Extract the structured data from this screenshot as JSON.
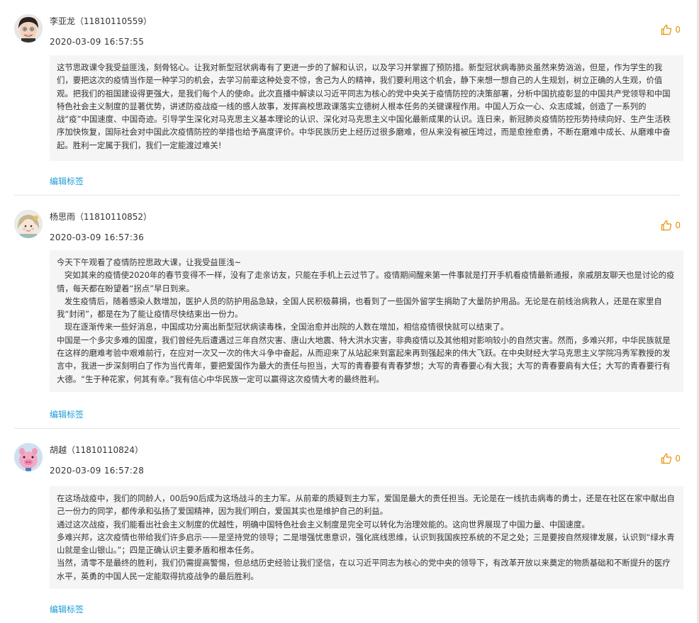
{
  "colors": {
    "accent_link": "#1e9dd6",
    "like_orange": "#e98f00",
    "content_bg": "#f5f5f5",
    "text": "#333333"
  },
  "comments": [
    {
      "author": "李亚龙（11810110559）",
      "time": "2020-03-09 16:57:55",
      "likes": "0",
      "avatar_icon": "boy-avatar-icon",
      "edit_label": "编辑标签",
      "paragraphs": [
        "这节思政课令我受益匪浅，刻骨铭心。让我对新型冠状病毒有了更进一步的了解和认识，以及学习并掌握了预防措。新型冠状病毒肺炎虽然来势汹汹，但是，作为学生的我们，要把这次的疫情当作是一种学习的机会，去学习前辈这种处变不惊，舍己为人的精神，我们要利用这个机会，静下来想一想自己的人生规划，树立正确的人生观，价值观。把我们的祖国建设得更强大，是我们每个人的使命。此次直播中解读以习近平同志为核心的党中央关于疫情防控的决策部署，分析中国抗疫彰显的中国共产党领导和中国特色社会主义制度的显著优势，讲述防疫战疫一线的感人故事，发挥高校思政课落实立德树人根本任务的关键课程作用。中国人万众一心、众志成城，创造了一系列的战“疫”中国速度、中国奇迹。引导学生深化对马克思主义基本理论的认识、深化对马克思主义中国化最新成果的认识。连日来，新冠肺炎疫情防控形势持续向好、生产生活秩序加快恢复，国际社会对中国此次疫情防控的举措也给予高度评价。中华民族历史上经历过很多磨难，但从来没有被压垮过，而是愈挫愈勇，不断在磨难中成长、从磨难中奋起。胜利一定属于我们，我们一定能渡过难关!"
      ]
    },
    {
      "author": "杨思雨（11810110852）",
      "time": "2020-03-09 16:57:36",
      "likes": "0",
      "avatar_icon": "girl-avatar-icon",
      "edit_label": "编辑标签",
      "paragraphs": [
        "今天下午观看了疫情防控思政大课，让我受益匪浅~",
        "   突如其来的疫情使2020年的春节变得不一样，没有了走亲访友，只能在手机上云过节了。疫情期间醒来第一件事就是打开手机看疫情最新通报，亲戚朋友聊天也是讨论的疫情，每天都在盼望着“拐点”早日到来。",
        "   发生疫情后，随着感染人数增加，医护人员的防护用品急缺，全国人民积极募捐，也看到了一些国外留学生捐助了大量防护用品。无论是在前线治病救人，还是在家里自我“封闭”，都是在为了能让疫情尽快结束出一份力。",
        "   现在逐渐传来一些好消息，中国成功分离出新型冠状病读毒株，全国治愈并出院的人数在增加，相信疫情很快就可以结束了。",
        "中国是一个多灾多难的国度，我们曾经先后遭遇过三年自然灾害、唐山大地震、特大洪水灾害，非典疫情以及其他相对影响较小的自然灾害。然而，多难兴邦，中华民族就是在这样的磨难考验中艰难前行，在应对一次又一次的伟大斗争中奋起，从而迎来了从站起来到富起来再到强起来的伟大飞跃。在中央财经大学马克思主义学院冯秀军教授的发言中，我进一步深刻明白了作为当代青年，要把爱国作为最大的责任与担当，大写的青春要有青春梦想；大写的青春要心有大我；大写的青春要肩有大任；大写的青春要行有大德。“生于种花家，何其有幸。”我有信心中华民族一定可以赢得这次疫情大考的最终胜利。"
      ]
    },
    {
      "author": "胡越（11810110824）",
      "time": "2020-03-09 16:57:28",
      "likes": "0",
      "avatar_icon": "pig-avatar-icon",
      "edit_label": "编辑标签",
      "paragraphs": [
        "在这场战疫中，我们的同龄人，00后90后成为这场战斗的主力军。从前辈的质疑到主力军，爱国是最大的责任担当。无论是在一线抗击病毒的勇士，还是在社区在家中献出自己一份力的同学，都传承和弘扬了爱国精神，因为我们明白，爱国其实也是维护自己的利益。",
        "通过这次战疫，我们能看出社会主义制度的优越性，明确中国特色社会主义制度是完全可以转化为治理效能的。这向世界展现了中国力量、中国速度。",
        "多难兴邦，这次疫情也带给我们许多启示——是坚持党的领导；二是增强忧患意识，强化底线思维，认识到我国疾控系统的不足之处；三是要按自然规律发展，认识到“绿水青山就是金山银山。”；四是正确认识主要矛盾和根本任务。",
        "当然，清零不是最终的胜利，我们仍需提高警惕，但总结历史经验让我们坚信，在以习近平同志为核心的党中央的领导下，有改革开放以来奠定的物质基础和不断提升的医疗水平，英勇的中国人民一定能取得抗疫战争的最后胜利。"
      ]
    }
  ]
}
